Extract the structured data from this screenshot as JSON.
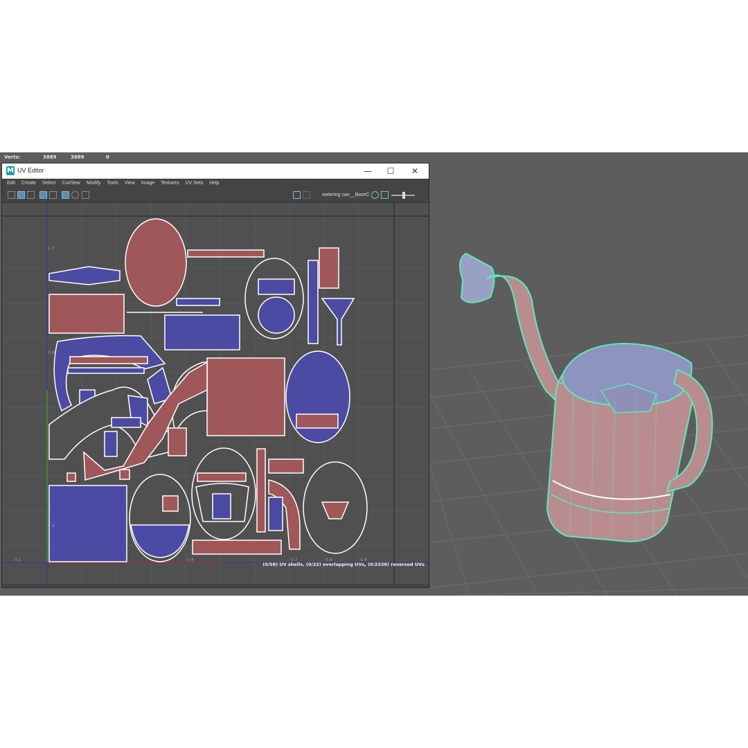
{
  "hud": {
    "label": "Verts:",
    "value1": "3889",
    "value2": "3889",
    "value3": "0"
  },
  "window": {
    "title": "UV Editor",
    "logo": "M",
    "controls": {
      "minimize": "—",
      "maximize": "☐",
      "close": "✕"
    }
  },
  "menu": [
    "Edit",
    "Create",
    "Select",
    "Cut/Sew",
    "Modify",
    "Tools",
    "View",
    "Image",
    "Textures",
    "UV Sets",
    "Help"
  ],
  "toolbar": {
    "texture_name": "watering can__BaseC"
  },
  "uv": {
    "status": "(0/58) UV shells, (0/22) overlapping UVs, (0/2338) reversed UVs",
    "ticks": [
      "0.1",
      "0.4",
      "0.7",
      "0.8",
      "0.9",
      "1.0",
      "0.6",
      "0.4"
    ]
  },
  "viewport": {
    "camera": "persp"
  },
  "colors": {
    "shell_red": "#a0575a",
    "shell_blue": "#4b4ba3",
    "wire_green": "#5fe8b8",
    "mesh_pink": "#b98d8f"
  }
}
